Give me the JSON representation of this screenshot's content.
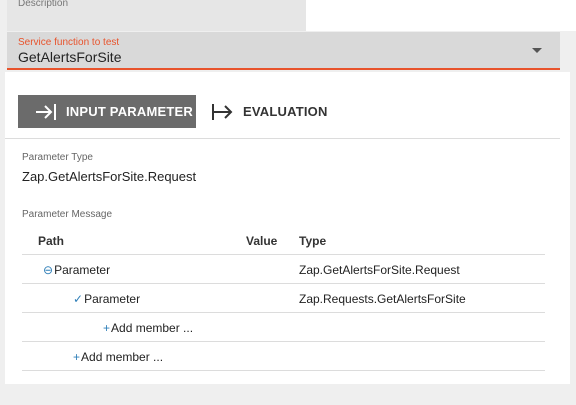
{
  "description": {
    "label": "Description"
  },
  "service_select": {
    "label": "Service function to test",
    "value": "GetAlertsForSite",
    "accent_color": "#e8532c"
  },
  "tabs": [
    {
      "label": "INPUT PARAMETER",
      "icon": "arrow-to-line-icon",
      "active": true
    },
    {
      "label": "EVALUATION",
      "icon": "arrow-from-line-icon",
      "active": false
    }
  ],
  "parameter_type": {
    "label": "Parameter Type",
    "value": "Zap.GetAlertsForSite.Request"
  },
  "parameter_message": {
    "label": "Parameter Message",
    "columns": {
      "path": "Path",
      "value": "Value",
      "type": "Type"
    },
    "rows": [
      {
        "glyph": "⊖",
        "path": "Parameter",
        "value": "",
        "type": "Zap.GetAlertsForSite.Request"
      },
      {
        "glyph": "✓",
        "path": "Parameter",
        "value": "",
        "type": "Zap.Requests.GetAlertsForSite"
      },
      {
        "glyph": "+",
        "path": "Add member ...",
        "value": "",
        "type": ""
      },
      {
        "glyph": "+",
        "path": "Add member ...",
        "value": "",
        "type": ""
      }
    ]
  }
}
